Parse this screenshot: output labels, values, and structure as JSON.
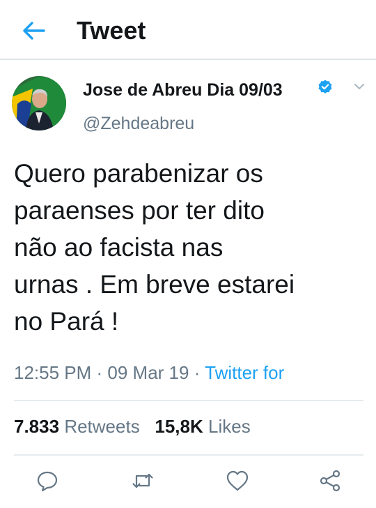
{
  "header": {
    "title": "Tweet"
  },
  "tweet": {
    "author_name": "Jose de Abreu Dia 09/03",
    "handle": "@Zehdeabreu",
    "text": "Quero parabenizar os\nparaenses por ter dito\nnão ao facista nas\nurnas . Em breve estarei\nno Pará !",
    "time": "12:55 PM",
    "date": "09 Mar 19",
    "source": "Twitter for",
    "separator": " · "
  },
  "stats": {
    "retweets_count": "7.833",
    "retweets_label": "Retweets",
    "likes_count": "15,8K",
    "likes_label": "Likes"
  },
  "colors": {
    "accent": "#1da1f2",
    "secondary_text": "#657786",
    "divider": "#e6ecf0"
  },
  "icons": {
    "back": "arrow-left-icon",
    "verified": "verified-badge-icon",
    "caret": "chevron-down-icon",
    "reply": "reply-icon",
    "retweet": "retweet-icon",
    "like": "heart-icon",
    "share": "share-icon"
  }
}
